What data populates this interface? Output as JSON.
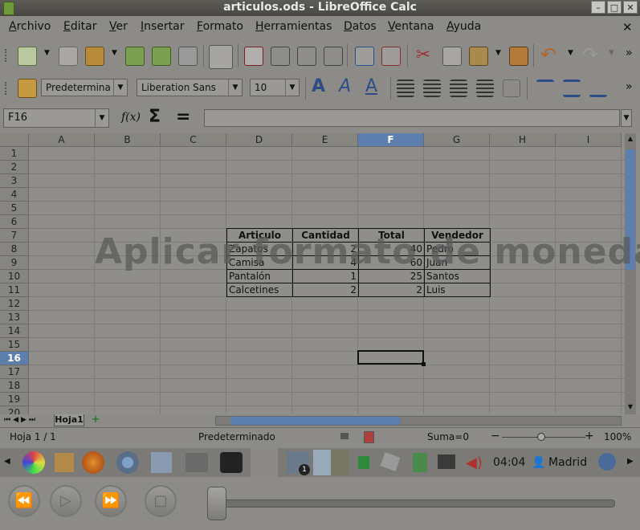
{
  "window": {
    "title": "articulos.ods - LibreOffice Calc",
    "min": "–",
    "max": "□",
    "close": "✕"
  },
  "menu": {
    "items": [
      "Archivo",
      "Editar",
      "Ver",
      "Insertar",
      "Formato",
      "Herramientas",
      "Datos",
      "Ventana",
      "Ayuda"
    ],
    "close": "✕"
  },
  "format_bar": {
    "style": "Predetermina",
    "font": "Liberation Sans",
    "size": "10"
  },
  "formula_bar": {
    "cell_ref": "F16",
    "fx": "f(x)",
    "sum": "Σ",
    "equals": "=",
    "content": ""
  },
  "columns": [
    "A",
    "B",
    "C",
    "D",
    "E",
    "F",
    "G",
    "H",
    "I"
  ],
  "selected_column": "F",
  "rows": [
    "1",
    "2",
    "3",
    "4",
    "5",
    "6",
    "7",
    "8",
    "9",
    "10",
    "11",
    "12",
    "13",
    "14",
    "15",
    "16",
    "17",
    "18",
    "19",
    "20"
  ],
  "selected_row": "16",
  "table": {
    "headers": [
      "Articulo",
      "Cantidad",
      "Total",
      "Vendedor"
    ],
    "rows": [
      [
        "Zapatos",
        "2",
        "40",
        "Pedro"
      ],
      [
        "Camisa",
        "4",
        "60",
        "Juan"
      ],
      [
        "Pantalón",
        "1",
        "25",
        "Santos"
      ],
      [
        "Calcetines",
        "2",
        "2",
        "Luis"
      ]
    ]
  },
  "watermark": "Aplicar formato de moneda",
  "sheet_tabs": {
    "active": "Hoja1",
    "add": "+"
  },
  "status": {
    "sheet": "Hoja 1 / 1",
    "style": "Predeterminado",
    "sum": "Suma=0",
    "zoom": "100%",
    "minus": "−",
    "plus": "+"
  },
  "taskbar": {
    "time": "04:04",
    "user": "Madrid",
    "badge": "1"
  }
}
